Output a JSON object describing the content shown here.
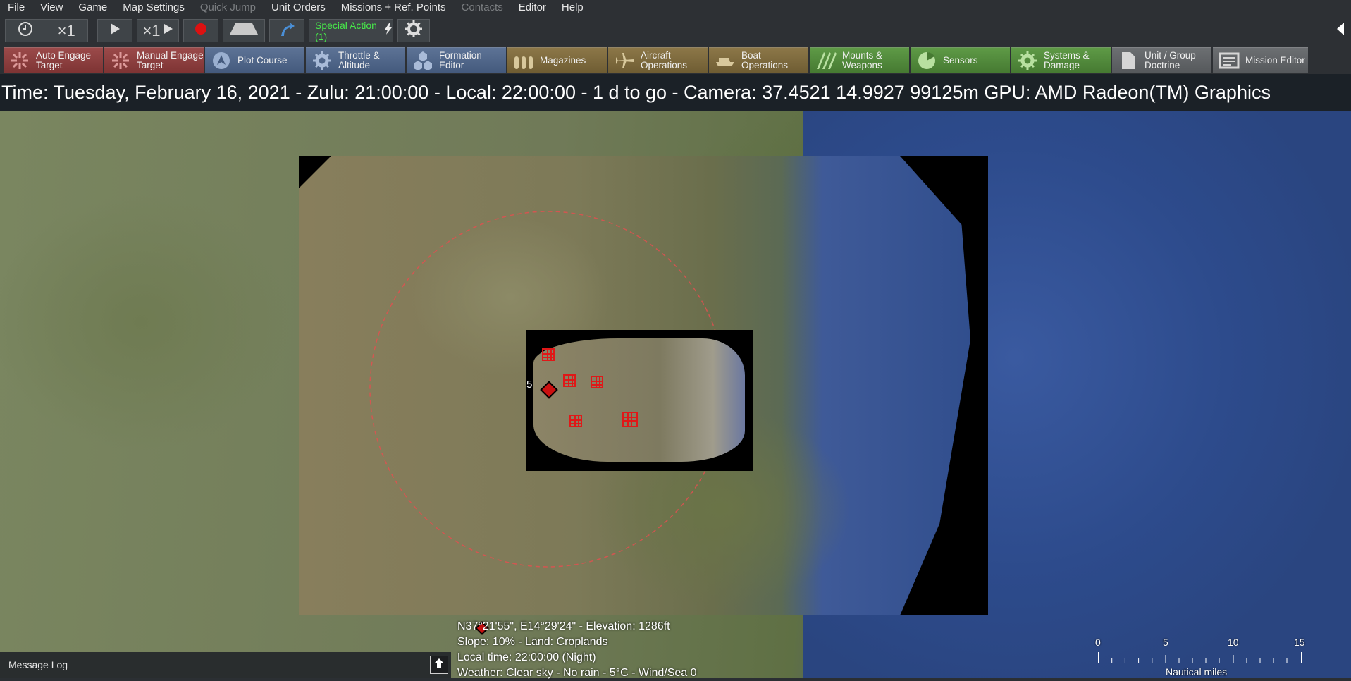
{
  "menu": [
    "File",
    "View",
    "Game",
    "Map Settings",
    "Quick Jump",
    "Unit Orders",
    "Missions + Ref. Points",
    "Contacts",
    "Editor",
    "Help"
  ],
  "menu_disabled": [
    "Quick Jump",
    "Contacts"
  ],
  "toolbar": {
    "clock_speed": "×1",
    "play_speed": "×1",
    "special_action": "Special Action (1)"
  },
  "commands": [
    {
      "label": "Auto Engage Target",
      "color": "red",
      "icon": "crosshair-icon"
    },
    {
      "label": "Manual Engage Target",
      "color": "red",
      "icon": "crosshair-icon"
    },
    {
      "label": "Plot Course",
      "color": "blue",
      "icon": "plot-course-icon"
    },
    {
      "label": "Throttle & Altitude",
      "color": "blue",
      "icon": "throttle-gear-icon"
    },
    {
      "label": "Formation Editor",
      "color": "blue",
      "icon": "formation-icon"
    },
    {
      "label": "Magazines",
      "color": "gold",
      "icon": "ammo-icon"
    },
    {
      "label": "Aircraft Operations",
      "color": "gold",
      "icon": "aircraft-icon"
    },
    {
      "label": "Boat Operations",
      "color": "gold",
      "icon": "boat-icon"
    },
    {
      "label": "Mounts & Weapons",
      "color": "green",
      "icon": "weapons-icon"
    },
    {
      "label": "Sensors",
      "color": "green",
      "icon": "radar-icon"
    },
    {
      "label": "Systems & Damage",
      "color": "green",
      "icon": "gear-icon"
    },
    {
      "label": "Unit / Group Doctrine",
      "color": "grey",
      "icon": "document-icon"
    },
    {
      "label": "Mission Editor",
      "color": "grey",
      "icon": "mission-icon"
    }
  ],
  "infobar": "Time: Tuesday, February 16, 2021 - Zulu: 21:00:00 - Local: 22:00:00 - 1 d to go -  Camera: 37.4521 14.9927 99125m  GPU: AMD Radeon(TM) Graphics",
  "map": {
    "unit_label": "5"
  },
  "message_log": "Message Log",
  "cursor_info": {
    "line1": "N37°21'55\", E14°29'24\" - Elevation: 1286ft",
    "line2": "Slope: 10%  - Land: Croplands",
    "line3": "Local time: 22:00:00 (Night)",
    "line4": "Weather: Clear sky - No rain - 5°C - Wind/Sea 0"
  },
  "scale": {
    "ticks": [
      "0",
      "5",
      "10",
      "15"
    ],
    "unit": "Nautical miles"
  }
}
